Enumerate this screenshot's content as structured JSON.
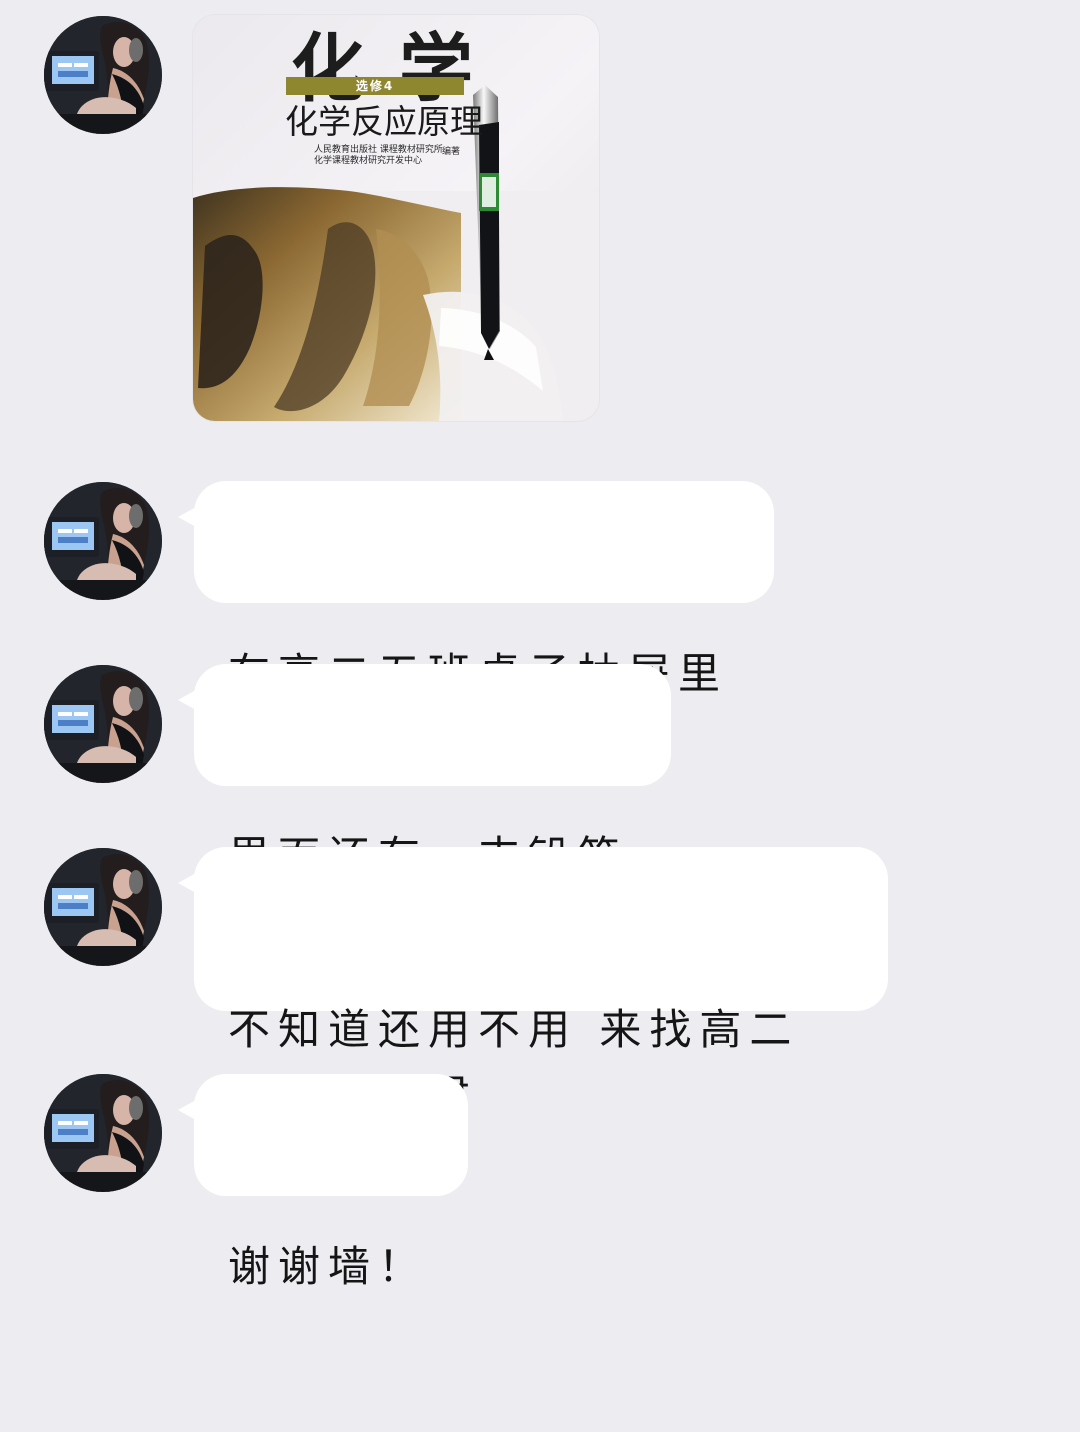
{
  "colors": {
    "background": "#ededf1",
    "bubble": "#ffffff",
    "text": "#151515",
    "book_accent": "#8f8630"
  },
  "messages": [
    {
      "type": "image",
      "image": {
        "book_title": "化学",
        "subtitle": "选修4",
        "heading": "化学反应原理",
        "publisher_line_1": "人民教育出版社  课程教材研究所",
        "publisher_line_2": "化学课程教材研究开发中心",
        "editor": "编著"
      }
    },
    {
      "type": "text",
      "text": "在高二五班桌子抽屉里"
    },
    {
      "type": "text",
      "text": "里面还有一支铅笔"
    },
    {
      "type": "text",
      "text": "不知道还用不用 来找高二\n五班韩卓君"
    },
    {
      "type": "text",
      "text": "谢谢墙！"
    }
  ]
}
